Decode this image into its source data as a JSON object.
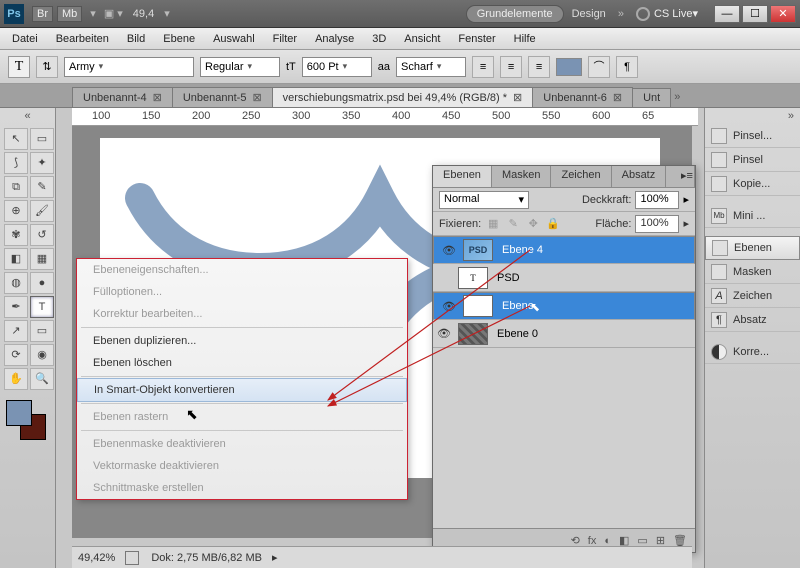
{
  "title_bar": {
    "app_icon": "Ps",
    "chips": [
      "Br",
      "Mb"
    ],
    "zoom": "49,4",
    "pill": "Grundelemente",
    "design": "Design",
    "cslive": "CS Live"
  },
  "menu": [
    "Datei",
    "Bearbeiten",
    "Bild",
    "Ebene",
    "Auswahl",
    "Filter",
    "Analyse",
    "3D",
    "Ansicht",
    "Fenster",
    "Hilfe"
  ],
  "options": {
    "tool": "T",
    "font": "Army",
    "weight": "Regular",
    "size_icon": "tT",
    "size": "600 Pt",
    "aa_label": "aa",
    "aa": "Scharf"
  },
  "tabs": [
    {
      "label": "Unbenannt-4",
      "active": false
    },
    {
      "label": "Unbenannt-5",
      "active": false
    },
    {
      "label": "verschiebungsmatrix.psd bei 49,4% (RGB/8) *",
      "active": true
    },
    {
      "label": "Unbenannt-6",
      "active": false
    },
    {
      "label": "Unt",
      "active": false
    }
  ],
  "ruler_marks": [
    "100",
    "150",
    "200",
    "250",
    "300",
    "350",
    "400",
    "450",
    "500",
    "550",
    "600",
    "65"
  ],
  "context_menu": {
    "items": [
      {
        "label": "Ebeneneigenschaften...",
        "enabled": false
      },
      {
        "label": "Fülloptionen...",
        "enabled": false
      },
      {
        "label": "Korrektur bearbeiten...",
        "enabled": false
      },
      {
        "sep": true
      },
      {
        "label": "Ebenen duplizieren...",
        "enabled": true
      },
      {
        "label": "Ebenen löschen",
        "enabled": true
      },
      {
        "sep": true
      },
      {
        "label": "In Smart-Objekt konvertieren",
        "enabled": true,
        "hover": true
      },
      {
        "sep": true
      },
      {
        "label": "Ebenen rastern",
        "enabled": false
      },
      {
        "sep": true
      },
      {
        "label": "Ebenenmaske deaktivieren",
        "enabled": false
      },
      {
        "label": "Vektormaske deaktivieren",
        "enabled": false
      },
      {
        "label": "Schnittmaske erstellen",
        "enabled": false
      }
    ]
  },
  "layers_panel": {
    "tabs": [
      "Ebenen",
      "Masken",
      "Zeichen",
      "Absatz"
    ],
    "blend": "Normal",
    "opacity_label": "Deckkraft:",
    "opacity": "100%",
    "lock_label": "Fixieren:",
    "fill_label": "Fläche:",
    "fill": "100%",
    "layers": [
      {
        "name": "Ebene 4",
        "type": "psd",
        "selected": true,
        "visible": true
      },
      {
        "name": "PSD",
        "type": "text",
        "selected": false,
        "visible": false
      },
      {
        "name": "Ebene",
        "type": "white",
        "selected": true,
        "visible": true
      },
      {
        "name": "Ebene 0",
        "type": "pattern",
        "selected": false,
        "visible": true
      }
    ],
    "foot_icons": [
      "⟲",
      "fx",
      "◐",
      "◧",
      "▭",
      "⊞",
      "🗑"
    ]
  },
  "right_dock": [
    {
      "label": "Pinsel...",
      "icon": "brush"
    },
    {
      "label": "Pinsel",
      "icon": "brush"
    },
    {
      "label": "Kopie...",
      "icon": "clone"
    },
    {
      "sep": true
    },
    {
      "label": "Mini ...",
      "icon": "mb",
      "mini": true
    },
    {
      "sep": true
    },
    {
      "label": "Ebenen",
      "icon": "layers",
      "active": true
    },
    {
      "label": "Masken",
      "icon": "mask"
    },
    {
      "label": "Zeichen",
      "icon": "char"
    },
    {
      "label": "Absatz",
      "icon": "para"
    },
    {
      "sep": true
    },
    {
      "label": "Korre...",
      "icon": "adj"
    }
  ],
  "status": {
    "zoom": "49,42%",
    "doc": "Dok: 2,75 MB/6,82 MB"
  },
  "colors": {
    "accent": "#3a87d8",
    "annotation": "#c02020"
  }
}
